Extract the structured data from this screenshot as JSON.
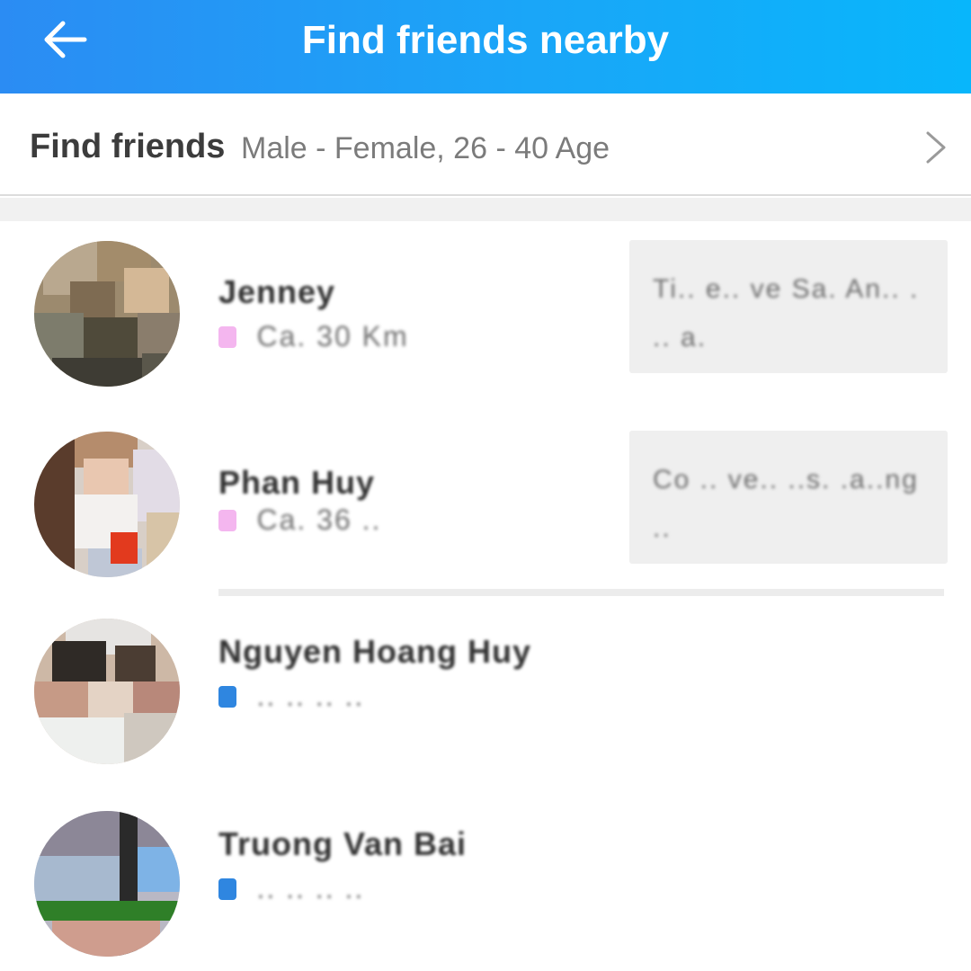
{
  "header": {
    "title": "Find friends nearby",
    "back_icon": "arrow-left-icon"
  },
  "filter": {
    "title": "Find friends",
    "detail": "Male - Female, 26 - 40 Age",
    "chevron_icon": "chevron-right-icon"
  },
  "people": [
    {
      "name": "Jenney",
      "meta": "Ca. 30 Km",
      "gender": "female",
      "gender_color": "#f4b6ef",
      "note": "Ti.. e.. ve Sa. An.. . .. a."
    },
    {
      "name": "Phan Huy",
      "meta": "Ca. 36 ..",
      "gender": "female",
      "gender_color": "#f4b6ef",
      "note": "Co .. ve.. ..s. .a..ng .."
    },
    {
      "name": "Nguyen Hoang Huy",
      "meta": ".. .. .. ..",
      "gender": "male",
      "gender_color": "#2f86e0",
      "note": ""
    },
    {
      "name": "Truong Van Bai",
      "meta": ".. .. .. ..",
      "gender": "male",
      "gender_color": "#2f86e0",
      "note": ""
    }
  ],
  "colors": {
    "header_start": "#2b8cf3",
    "header_end": "#08b6fb",
    "female": "#f4b6ef",
    "male": "#2f86e0"
  }
}
